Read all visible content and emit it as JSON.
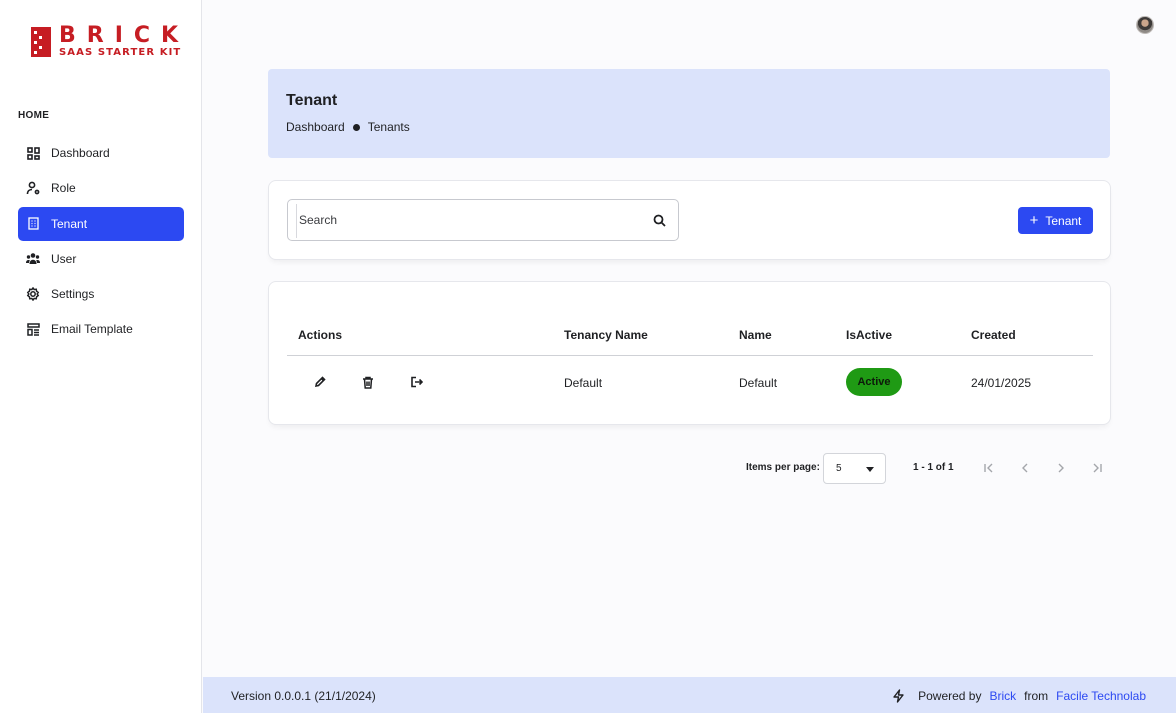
{
  "brand": {
    "word": "BRICK",
    "sub": "SAAS STARTER KIT",
    "color": "#c61d23"
  },
  "accent_color": "#2c49f2",
  "sidebar": {
    "heading": "HOME",
    "items": [
      {
        "label": "Dashboard",
        "icon": "dashboard-icon"
      },
      {
        "label": "Role",
        "icon": "role-icon"
      },
      {
        "label": "Tenant",
        "icon": "building-icon",
        "active": true
      },
      {
        "label": "User",
        "icon": "users-icon"
      },
      {
        "label": "Settings",
        "icon": "gear-icon"
      },
      {
        "label": "Email Template",
        "icon": "email-template-icon"
      }
    ]
  },
  "header": {
    "title": "Tenant",
    "breadcrumb": [
      "Dashboard",
      "Tenants"
    ]
  },
  "search": {
    "placeholder": "Search",
    "value": ""
  },
  "add_button": {
    "label": "Tenant"
  },
  "table": {
    "columns": [
      "Actions",
      "Tenancy Name",
      "Name",
      "IsActive",
      "Created"
    ],
    "rows": [
      {
        "tenancy_name": "Default",
        "name": "Default",
        "is_active": "Active",
        "created": "24/01/2025"
      }
    ]
  },
  "pagination": {
    "items_per_page_label": "Items per page:",
    "items_per_page": "5",
    "range": "1 - 1 of 1"
  },
  "footer": {
    "version": "Version 0.0.0.1 (21/1/2024)",
    "powered_by": "Powered by",
    "brand_link": "Brick",
    "from": "from",
    "company_link": "Facile Technolab"
  }
}
